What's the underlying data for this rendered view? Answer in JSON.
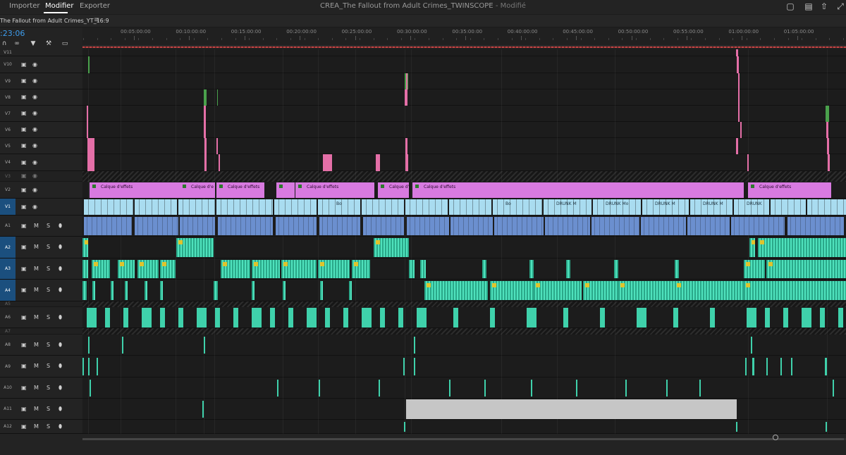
{
  "menu": {
    "items": [
      {
        "label": "Importer",
        "active": false
      },
      {
        "label": "Modifier",
        "active": true
      },
      {
        "label": "Exporter",
        "active": false
      }
    ]
  },
  "document": {
    "title": "CREA_The Fallout from Adult Crimes_TWINSCOPE",
    "status": "- Modifié"
  },
  "topbar_icons": [
    "notification-icon",
    "settings-panel-icon",
    "share-icon",
    "fullscreen-icon"
  ],
  "sequence": {
    "tab_label": "The Fallout from Adult Crimes_YT_16:9",
    "menu_glyph": "≡"
  },
  "timecode": ":23:06",
  "tools": [
    "snap-icon",
    "linked-selection-icon",
    "marker-icon",
    "wrench-icon",
    "captions-icon"
  ],
  "ruler": {
    "labels": [
      "00:05:00:00",
      "00:10:00:00",
      "00:15:00:00",
      "00:20:00:00",
      "00:25:00:00",
      "00:30:00:00",
      "00:35:00:00",
      "00:40:00:00",
      "00:45:00:00",
      "00:50:00:00",
      "00:55:00:00",
      "01:00:00:00",
      "01:05:00:00"
    ]
  },
  "tracks": {
    "video": [
      "V11",
      "V10",
      "V9",
      "V8",
      "V7",
      "V6",
      "V5",
      "V4",
      "V3",
      "V2",
      "V1"
    ],
    "audio": [
      "A1",
      "A2",
      "A3",
      "A4",
      "A5",
      "A6",
      "A7",
      "A8",
      "A9",
      "A10",
      "A11",
      "A12"
    ],
    "mute_label": "M",
    "solo_label": "S"
  },
  "clips": {
    "effects_label": "Calque d'effets",
    "effects_short": "Calque d'e",
    "effects_cut": "Calque d'",
    "v1_labels": [
      "Bo",
      "DRUNK M",
      "DRUNK Mo",
      "DRUNK M",
      "DRUNK M",
      "DRUNK",
      "DR"
    ]
  },
  "colors": {
    "pink": "#e46fa7",
    "green": "#4aa14c",
    "effects_layer": "#d87ae0",
    "v1_clip": "#a9dcf0",
    "a1_clip": "#6b8fcf",
    "audio_clip": "#3fd1ab",
    "timecode": "#3e9ded",
    "selected_track": "#1b4f7e"
  }
}
